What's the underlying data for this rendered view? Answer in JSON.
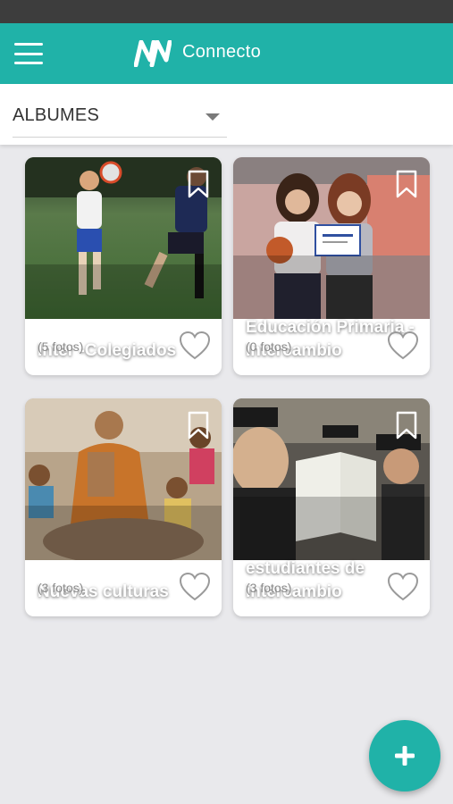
{
  "app": {
    "title": "Connecto",
    "accent_color": "#20b2a8",
    "menu_icon": "hamburger-menu-icon",
    "logo_icon": "connecto-logo-icon"
  },
  "filter": {
    "selected": "ALBUMES",
    "icon": "chevron-down-icon"
  },
  "albums": [
    {
      "title": "Inter -Colegiados",
      "count": "(5 fotos)",
      "image": "soccer-players-photo"
    },
    {
      "title": "Educación Primaria - Intercambio",
      "count": "(0 fotos)",
      "image": "students-with-certificate-photo"
    },
    {
      "title": "Nuevas culturas",
      "count": "(3 fotos)",
      "image": "monk-with-children-photo"
    },
    {
      "title": "estudiantes de intercambio",
      "count": "(3 fotos)",
      "image": "students-reading-photo"
    }
  ],
  "fab": {
    "icon": "plus-icon"
  }
}
